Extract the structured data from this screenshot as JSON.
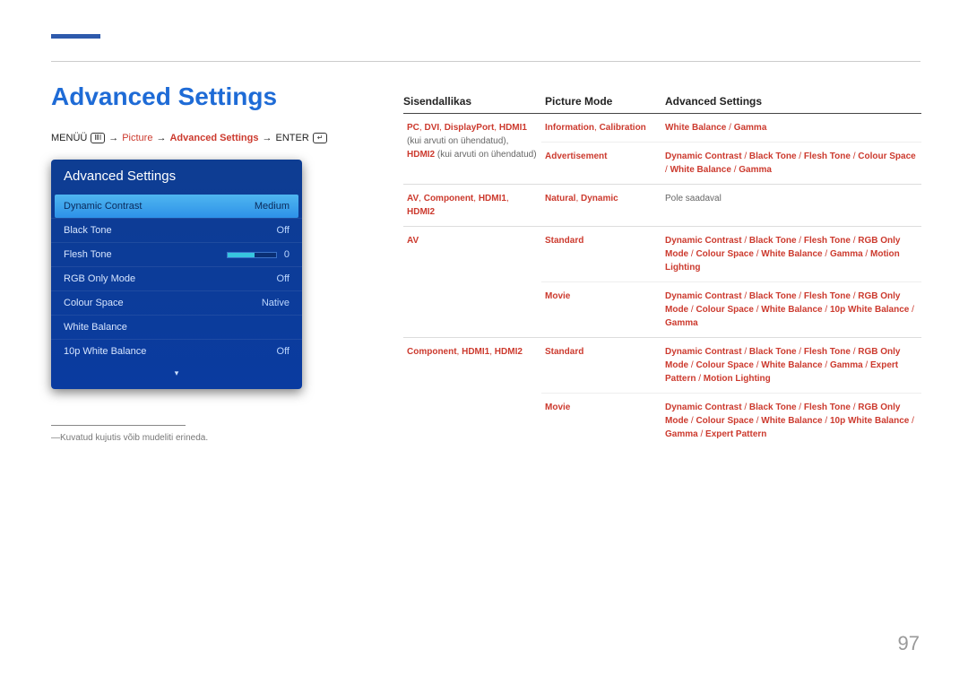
{
  "title": "Advanced Settings",
  "page_number": "97",
  "breadcrumb": {
    "menu": "MENÜÜ",
    "arrow": "→",
    "picture": "Picture",
    "advanced": "Advanced Settings",
    "enter": "ENTER"
  },
  "menu": {
    "title": "Advanced Settings",
    "items": [
      {
        "label": "Dynamic Contrast",
        "value": "Medium",
        "selected": true
      },
      {
        "label": "Black Tone",
        "value": "Off"
      },
      {
        "label": "Flesh Tone",
        "value": "0",
        "slider": true
      },
      {
        "label": "RGB Only Mode",
        "value": "Off"
      },
      {
        "label": "Colour Space",
        "value": "Native"
      },
      {
        "label": "White Balance",
        "value": ""
      },
      {
        "label": "10p White Balance",
        "value": "Off"
      }
    ]
  },
  "footnote": "Kuvatud kujutis võib mudeliti erineda.",
  "table": {
    "headers": {
      "c1": "Sisendallikas",
      "c2": "Picture Mode",
      "c3": "Advanced Settings"
    },
    "rows": [
      {
        "c1_parts": [
          {
            "t": "PC",
            "c": "hlb"
          },
          {
            "t": ", ",
            "c": "hl"
          },
          {
            "t": "DVI",
            "c": "hlb"
          },
          {
            "t": ", ",
            "c": "hl"
          },
          {
            "t": "DisplayPort",
            "c": "hlb"
          },
          {
            "t": ", ",
            "c": "hl"
          },
          {
            "t": "HDMI1",
            "c": "hlb"
          },
          {
            "t": " (kui arvuti on ühendatud), ",
            "c": "plain"
          },
          {
            "t": "HDMI2",
            "c": "hlb"
          },
          {
            "t": " (kui arvuti on ühendatud)",
            "c": "plain"
          }
        ],
        "sub": [
          {
            "c2": [
              {
                "t": "Information",
                "c": "hlb"
              },
              {
                "t": ", ",
                "c": "hl"
              },
              {
                "t": "Calibration",
                "c": "hlb"
              }
            ],
            "c3": [
              {
                "t": "White Balance",
                "c": "hlb"
              },
              {
                "t": " / ",
                "c": "hl"
              },
              {
                "t": "Gamma",
                "c": "hlb"
              }
            ]
          },
          {
            "c2": [
              {
                "t": "Advertisement",
                "c": "hlb"
              }
            ],
            "c3": [
              {
                "t": "Dynamic Contrast",
                "c": "hlb"
              },
              {
                "t": " / ",
                "c": "hl"
              },
              {
                "t": "Black Tone",
                "c": "hlb"
              },
              {
                "t": " / ",
                "c": "hl"
              },
              {
                "t": "Flesh Tone",
                "c": "hlb"
              },
              {
                "t": " / ",
                "c": "hl"
              },
              {
                "t": "Colour Space",
                "c": "hlb"
              },
              {
                "t": " / ",
                "c": "hl"
              },
              {
                "t": "White Balance",
                "c": "hlb"
              },
              {
                "t": " / ",
                "c": "hl"
              },
              {
                "t": "Gamma",
                "c": "hlb"
              }
            ]
          }
        ]
      },
      {
        "c1_parts": [
          {
            "t": "AV",
            "c": "hlb"
          },
          {
            "t": ", ",
            "c": "hl"
          },
          {
            "t": "Component",
            "c": "hlb"
          },
          {
            "t": ", ",
            "c": "hl"
          },
          {
            "t": "HDMI1",
            "c": "hlb"
          },
          {
            "t": ", ",
            "c": "hl"
          },
          {
            "t": "HDMI2",
            "c": "hlb"
          }
        ],
        "sub": [
          {
            "c2": [
              {
                "t": "Natural",
                "c": "hlb"
              },
              {
                "t": ", ",
                "c": "hl"
              },
              {
                "t": "Dynamic",
                "c": "hlb"
              }
            ],
            "c3": [
              {
                "t": "Pole saadaval",
                "c": "plain"
              }
            ]
          }
        ]
      },
      {
        "c1_parts": [
          {
            "t": "AV",
            "c": "hlb"
          }
        ],
        "sub": [
          {
            "c2": [
              {
                "t": "Standard",
                "c": "hlb"
              }
            ],
            "c3": [
              {
                "t": "Dynamic Contrast",
                "c": "hlb"
              },
              {
                "t": " / ",
                "c": "hl"
              },
              {
                "t": "Black Tone",
                "c": "hlb"
              },
              {
                "t": " / ",
                "c": "hl"
              },
              {
                "t": "Flesh Tone",
                "c": "hlb"
              },
              {
                "t": " / ",
                "c": "hl"
              },
              {
                "t": "RGB Only Mode",
                "c": "hlb"
              },
              {
                "t": " / ",
                "c": "hl"
              },
              {
                "t": "Colour Space",
                "c": "hlb"
              },
              {
                "t": " / ",
                "c": "hl"
              },
              {
                "t": "White Balance",
                "c": "hlb"
              },
              {
                "t": " / ",
                "c": "hl"
              },
              {
                "t": "Gamma",
                "c": "hlb"
              },
              {
                "t": " / ",
                "c": "hl"
              },
              {
                "t": "Motion Lighting",
                "c": "hlb"
              }
            ]
          },
          {
            "c2": [
              {
                "t": "Movie",
                "c": "hlb"
              }
            ],
            "c3": [
              {
                "t": "Dynamic Contrast",
                "c": "hlb"
              },
              {
                "t": " / ",
                "c": "hl"
              },
              {
                "t": "Black Tone",
                "c": "hlb"
              },
              {
                "t": " / ",
                "c": "hl"
              },
              {
                "t": "Flesh Tone",
                "c": "hlb"
              },
              {
                "t": " / ",
                "c": "hl"
              },
              {
                "t": "RGB Only Mode",
                "c": "hlb"
              },
              {
                "t": " / ",
                "c": "hl"
              },
              {
                "t": "Colour Space",
                "c": "hlb"
              },
              {
                "t": " / ",
                "c": "hl"
              },
              {
                "t": "White Balance",
                "c": "hlb"
              },
              {
                "t": " / ",
                "c": "hl"
              },
              {
                "t": "10p White Balance",
                "c": "hlb"
              },
              {
                "t": " / ",
                "c": "hl"
              },
              {
                "t": "Gamma",
                "c": "hlb"
              }
            ]
          }
        ]
      },
      {
        "c1_parts": [
          {
            "t": "Component",
            "c": "hlb"
          },
          {
            "t": ", ",
            "c": "hl"
          },
          {
            "t": "HDMI1",
            "c": "hlb"
          },
          {
            "t": ", ",
            "c": "hl"
          },
          {
            "t": "HDMI2",
            "c": "hlb"
          }
        ],
        "sub": [
          {
            "c2": [
              {
                "t": "Standard",
                "c": "hlb"
              }
            ],
            "c3": [
              {
                "t": "Dynamic Contrast",
                "c": "hlb"
              },
              {
                "t": " / ",
                "c": "hl"
              },
              {
                "t": "Black Tone",
                "c": "hlb"
              },
              {
                "t": " / ",
                "c": "hl"
              },
              {
                "t": "Flesh Tone",
                "c": "hlb"
              },
              {
                "t": " / ",
                "c": "hl"
              },
              {
                "t": "RGB Only Mode",
                "c": "hlb"
              },
              {
                "t": " / ",
                "c": "hl"
              },
              {
                "t": "Colour Space",
                "c": "hlb"
              },
              {
                "t": " / ",
                "c": "hl"
              },
              {
                "t": "White Balance",
                "c": "hlb"
              },
              {
                "t": " / ",
                "c": "hl"
              },
              {
                "t": "Gamma",
                "c": "hlb"
              },
              {
                "t": " / ",
                "c": "hl"
              },
              {
                "t": "Expert Pattern",
                "c": "hlb"
              },
              {
                "t": " / ",
                "c": "hl"
              },
              {
                "t": "Motion Lighting",
                "c": "hlb"
              }
            ]
          },
          {
            "c2": [
              {
                "t": "Movie",
                "c": "hlb"
              }
            ],
            "c3": [
              {
                "t": "Dynamic Contrast",
                "c": "hlb"
              },
              {
                "t": " / ",
                "c": "hl"
              },
              {
                "t": "Black Tone",
                "c": "hlb"
              },
              {
                "t": " / ",
                "c": "hl"
              },
              {
                "t": "Flesh Tone",
                "c": "hlb"
              },
              {
                "t": " / ",
                "c": "hl"
              },
              {
                "t": "RGB Only Mode",
                "c": "hlb"
              },
              {
                "t": " / ",
                "c": "hl"
              },
              {
                "t": "Colour Space",
                "c": "hlb"
              },
              {
                "t": " / ",
                "c": "hl"
              },
              {
                "t": "White Balance",
                "c": "hlb"
              },
              {
                "t": " / ",
                "c": "hl"
              },
              {
                "t": "10p White Balance",
                "c": "hlb"
              },
              {
                "t": " / ",
                "c": "hl"
              },
              {
                "t": "Gamma",
                "c": "hlb"
              },
              {
                "t": " / ",
                "c": "hl"
              },
              {
                "t": "Expert Pattern",
                "c": "hlb"
              }
            ]
          }
        ]
      }
    ]
  }
}
